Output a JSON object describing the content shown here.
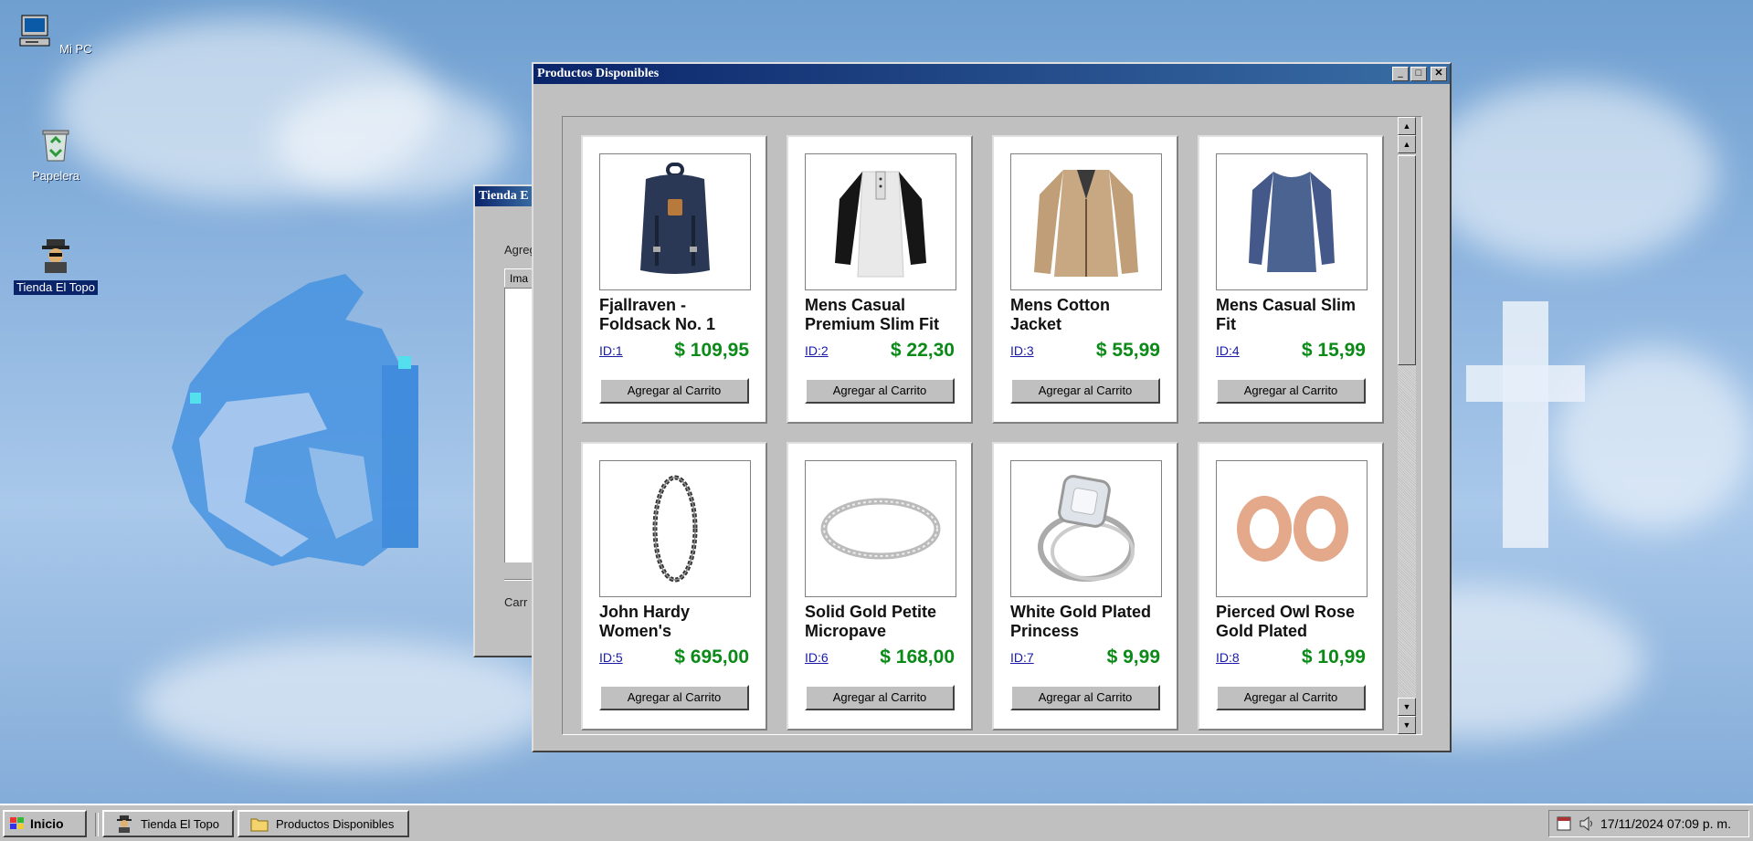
{
  "desktop": {
    "icons": [
      {
        "label": "Mi PC"
      },
      {
        "label": "Papelera"
      },
      {
        "label": "Tienda El Topo"
      }
    ]
  },
  "back_window": {
    "title": "Tienda E",
    "frag_top": "Agreg",
    "tab_label": "Ima",
    "frag_bottom": "Carr"
  },
  "products_window": {
    "title": "Productos Disponibles",
    "controls": {
      "minimize": "_",
      "maximize": "□",
      "close": "✕"
    },
    "products": [
      {
        "name": "Fjallraven - Foldsack No. 1",
        "id": "ID:1",
        "price": "$ 109,95",
        "button": "Agregar al Carrito",
        "image": "backpack"
      },
      {
        "name": "Mens Casual Premium Slim Fit",
        "id": "ID:2",
        "price": "$ 22,30",
        "button": "Agregar al Carrito",
        "image": "raglan-shirt"
      },
      {
        "name": "Mens Cotton Jacket",
        "id": "ID:3",
        "price": "$ 55,99",
        "button": "Agregar al Carrito",
        "image": "jacket"
      },
      {
        "name": "Mens Casual Slim Fit",
        "id": "ID:4",
        "price": "$ 15,99",
        "button": "Agregar al Carrito",
        "image": "blue-shirt"
      },
      {
        "name": "John Hardy Women's",
        "id": "ID:5",
        "price": "$ 695,00",
        "button": "Agregar al Carrito",
        "image": "bracelet"
      },
      {
        "name": "Solid Gold Petite Micropave",
        "id": "ID:6",
        "price": "$ 168,00",
        "button": "Agregar al Carrito",
        "image": "ring"
      },
      {
        "name": "White Gold Plated Princess",
        "id": "ID:7",
        "price": "$ 9,99",
        "button": "Agregar al Carrito",
        "image": "diamond-ring"
      },
      {
        "name": "Pierced Owl Rose Gold Plated",
        "id": "ID:8",
        "price": "$ 10,99",
        "button": "Agregar al Carrito",
        "image": "plugs"
      }
    ]
  },
  "taskbar": {
    "start_label": "Inicio",
    "tasks": [
      {
        "label": "Tienda El Topo"
      },
      {
        "label": "Productos Disponibles"
      }
    ],
    "clock": "17/11/2024 07:09 p. m."
  }
}
